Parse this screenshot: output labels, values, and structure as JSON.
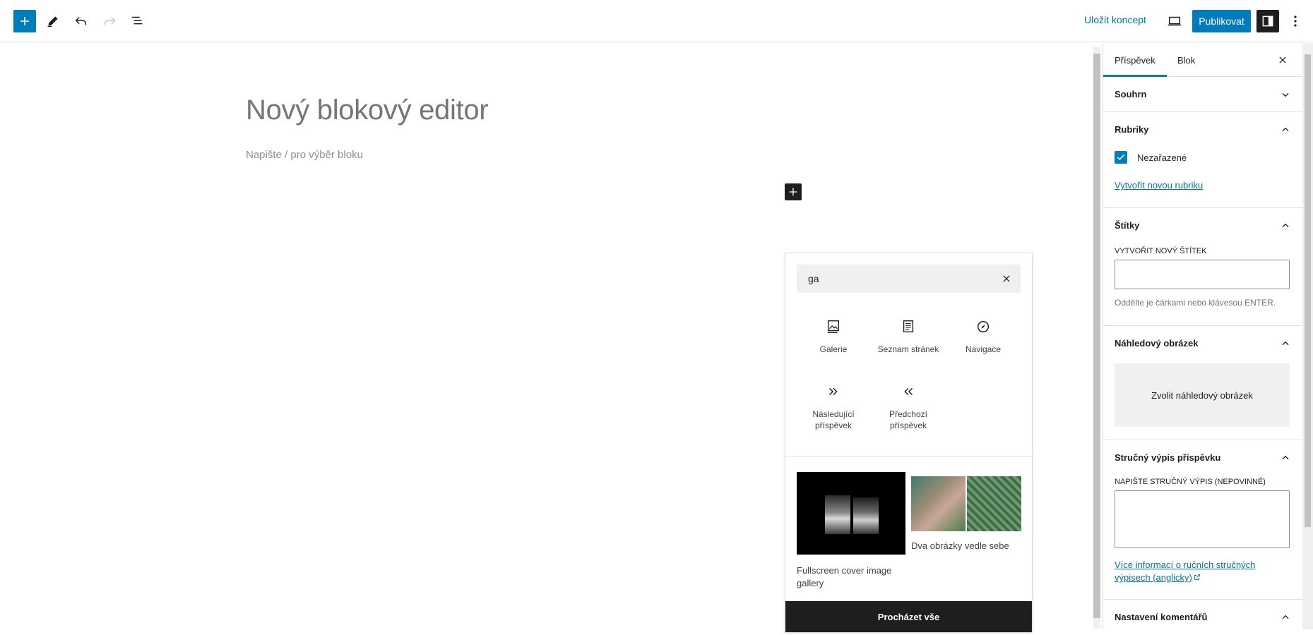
{
  "topbar": {
    "save_draft": "Uložit koncept",
    "publish": "Publikovat"
  },
  "editor": {
    "title": "Nový blokový editor",
    "placeholder": "Napište / pro výběr bloku"
  },
  "inserter": {
    "search_value": "ga",
    "blocks": [
      {
        "label": "Galerie",
        "icon": "gallery-icon"
      },
      {
        "label": "Seznam stránek",
        "icon": "page-list-icon"
      },
      {
        "label": "Navigace",
        "icon": "navigation-compass-icon"
      },
      {
        "label": "Následující příspěvek",
        "icon": "next-post-icon"
      },
      {
        "label": "Předchozí příspěvek",
        "icon": "previous-post-icon"
      }
    ],
    "patterns": [
      {
        "label": "Fullscreen cover image gallery"
      },
      {
        "label": "Dva obrázky vedle sebe"
      }
    ],
    "browse_all": "Procházet vše"
  },
  "sidebar": {
    "tabs": [
      "Příspěvek",
      "Blok"
    ],
    "summary": "Souhrn",
    "categories": {
      "title": "Rubriky",
      "items": [
        {
          "label": "Nezařazené",
          "checked": true
        }
      ],
      "add_link": "Vytvořit novou rubriku"
    },
    "tags": {
      "title": "Štítky",
      "input_label": "VYTVOŘIT NOVÝ ŠTÍTEK",
      "help": "Oddělte je čárkami nebo klávesou ENTER."
    },
    "featured_image": {
      "title": "Náhledový obrázek",
      "button": "Zvolit náhledový obrázek"
    },
    "excerpt": {
      "title": "Stručný výpis příspěvku",
      "input_label": "NAPIŠTE STRUČNÝ VÝPIS (NEPOVINNÉ)",
      "link": "Více informací o ručních stručných výpisech (anglicky)"
    },
    "discussion": {
      "title": "Nastavení komentářů"
    }
  },
  "colors": {
    "accent": "#007cba",
    "dark": "#1e1e1e"
  }
}
